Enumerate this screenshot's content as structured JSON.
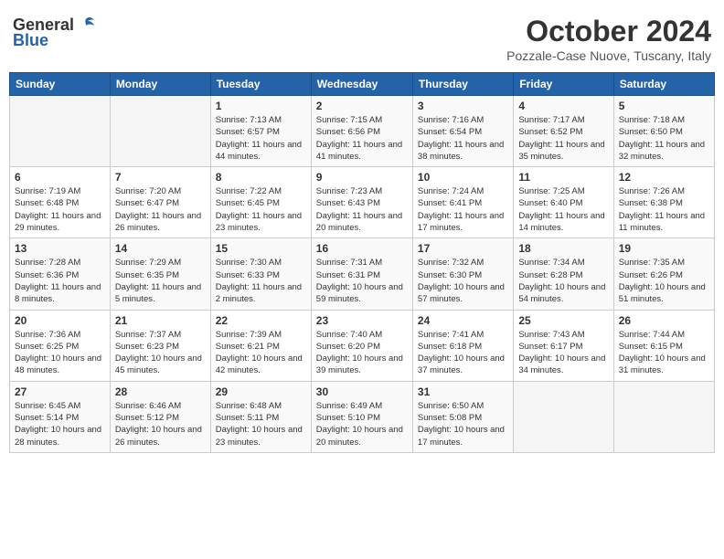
{
  "header": {
    "logo_general": "General",
    "logo_blue": "Blue",
    "title": "October 2024",
    "location": "Pozzale-Case Nuove, Tuscany, Italy"
  },
  "days_of_week": [
    "Sunday",
    "Monday",
    "Tuesday",
    "Wednesday",
    "Thursday",
    "Friday",
    "Saturday"
  ],
  "weeks": [
    [
      {
        "day": "",
        "info": ""
      },
      {
        "day": "",
        "info": ""
      },
      {
        "day": "1",
        "info": "Sunrise: 7:13 AM\nSunset: 6:57 PM\nDaylight: 11 hours and 44 minutes."
      },
      {
        "day": "2",
        "info": "Sunrise: 7:15 AM\nSunset: 6:56 PM\nDaylight: 11 hours and 41 minutes."
      },
      {
        "day": "3",
        "info": "Sunrise: 7:16 AM\nSunset: 6:54 PM\nDaylight: 11 hours and 38 minutes."
      },
      {
        "day": "4",
        "info": "Sunrise: 7:17 AM\nSunset: 6:52 PM\nDaylight: 11 hours and 35 minutes."
      },
      {
        "day": "5",
        "info": "Sunrise: 7:18 AM\nSunset: 6:50 PM\nDaylight: 11 hours and 32 minutes."
      }
    ],
    [
      {
        "day": "6",
        "info": "Sunrise: 7:19 AM\nSunset: 6:48 PM\nDaylight: 11 hours and 29 minutes."
      },
      {
        "day": "7",
        "info": "Sunrise: 7:20 AM\nSunset: 6:47 PM\nDaylight: 11 hours and 26 minutes."
      },
      {
        "day": "8",
        "info": "Sunrise: 7:22 AM\nSunset: 6:45 PM\nDaylight: 11 hours and 23 minutes."
      },
      {
        "day": "9",
        "info": "Sunrise: 7:23 AM\nSunset: 6:43 PM\nDaylight: 11 hours and 20 minutes."
      },
      {
        "day": "10",
        "info": "Sunrise: 7:24 AM\nSunset: 6:41 PM\nDaylight: 11 hours and 17 minutes."
      },
      {
        "day": "11",
        "info": "Sunrise: 7:25 AM\nSunset: 6:40 PM\nDaylight: 11 hours and 14 minutes."
      },
      {
        "day": "12",
        "info": "Sunrise: 7:26 AM\nSunset: 6:38 PM\nDaylight: 11 hours and 11 minutes."
      }
    ],
    [
      {
        "day": "13",
        "info": "Sunrise: 7:28 AM\nSunset: 6:36 PM\nDaylight: 11 hours and 8 minutes."
      },
      {
        "day": "14",
        "info": "Sunrise: 7:29 AM\nSunset: 6:35 PM\nDaylight: 11 hours and 5 minutes."
      },
      {
        "day": "15",
        "info": "Sunrise: 7:30 AM\nSunset: 6:33 PM\nDaylight: 11 hours and 2 minutes."
      },
      {
        "day": "16",
        "info": "Sunrise: 7:31 AM\nSunset: 6:31 PM\nDaylight: 10 hours and 59 minutes."
      },
      {
        "day": "17",
        "info": "Sunrise: 7:32 AM\nSunset: 6:30 PM\nDaylight: 10 hours and 57 minutes."
      },
      {
        "day": "18",
        "info": "Sunrise: 7:34 AM\nSunset: 6:28 PM\nDaylight: 10 hours and 54 minutes."
      },
      {
        "day": "19",
        "info": "Sunrise: 7:35 AM\nSunset: 6:26 PM\nDaylight: 10 hours and 51 minutes."
      }
    ],
    [
      {
        "day": "20",
        "info": "Sunrise: 7:36 AM\nSunset: 6:25 PM\nDaylight: 10 hours and 48 minutes."
      },
      {
        "day": "21",
        "info": "Sunrise: 7:37 AM\nSunset: 6:23 PM\nDaylight: 10 hours and 45 minutes."
      },
      {
        "day": "22",
        "info": "Sunrise: 7:39 AM\nSunset: 6:21 PM\nDaylight: 10 hours and 42 minutes."
      },
      {
        "day": "23",
        "info": "Sunrise: 7:40 AM\nSunset: 6:20 PM\nDaylight: 10 hours and 39 minutes."
      },
      {
        "day": "24",
        "info": "Sunrise: 7:41 AM\nSunset: 6:18 PM\nDaylight: 10 hours and 37 minutes."
      },
      {
        "day": "25",
        "info": "Sunrise: 7:43 AM\nSunset: 6:17 PM\nDaylight: 10 hours and 34 minutes."
      },
      {
        "day": "26",
        "info": "Sunrise: 7:44 AM\nSunset: 6:15 PM\nDaylight: 10 hours and 31 minutes."
      }
    ],
    [
      {
        "day": "27",
        "info": "Sunrise: 6:45 AM\nSunset: 5:14 PM\nDaylight: 10 hours and 28 minutes."
      },
      {
        "day": "28",
        "info": "Sunrise: 6:46 AM\nSunset: 5:12 PM\nDaylight: 10 hours and 26 minutes."
      },
      {
        "day": "29",
        "info": "Sunrise: 6:48 AM\nSunset: 5:11 PM\nDaylight: 10 hours and 23 minutes."
      },
      {
        "day": "30",
        "info": "Sunrise: 6:49 AM\nSunset: 5:10 PM\nDaylight: 10 hours and 20 minutes."
      },
      {
        "day": "31",
        "info": "Sunrise: 6:50 AM\nSunset: 5:08 PM\nDaylight: 10 hours and 17 minutes."
      },
      {
        "day": "",
        "info": ""
      },
      {
        "day": "",
        "info": ""
      }
    ]
  ]
}
